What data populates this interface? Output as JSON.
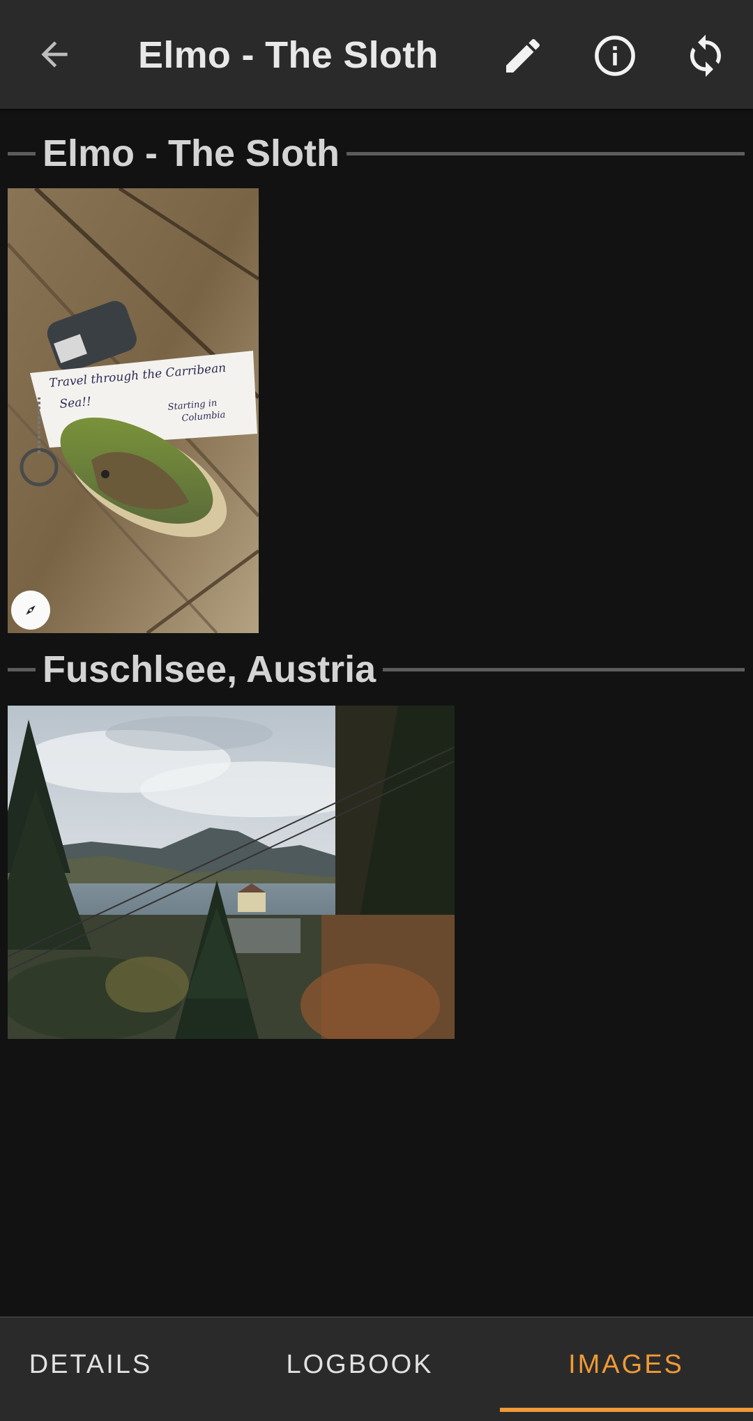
{
  "appbar": {
    "title": "Elmo - The Sloth",
    "back_icon": "arrow-back-icon",
    "actions": [
      "edit-pencil-icon",
      "info-icon",
      "refresh-sync-icon"
    ]
  },
  "sections": [
    {
      "title": "Elmo - The Sloth",
      "images": [
        {
          "description_icon": "compass-icon",
          "note_text_line1": "Travel through the Carribean",
          "note_text_line2": "Sea!!",
          "note_text_line3": "Starting in",
          "note_text_line4": "Columbia"
        }
      ]
    },
    {
      "title": "Fuschlsee, Austria",
      "images": [
        {
          "alt": ""
        }
      ]
    }
  ],
  "tabs": [
    {
      "label": "DETAILS",
      "active": false
    },
    {
      "label": "LOGBOOK",
      "active": false
    },
    {
      "label": "IMAGES",
      "active": true
    }
  ],
  "colors": {
    "background": "#121212",
    "appbar": "#2a2a2a",
    "accent": "#f09a36",
    "divider": "#5c5c5c"
  }
}
